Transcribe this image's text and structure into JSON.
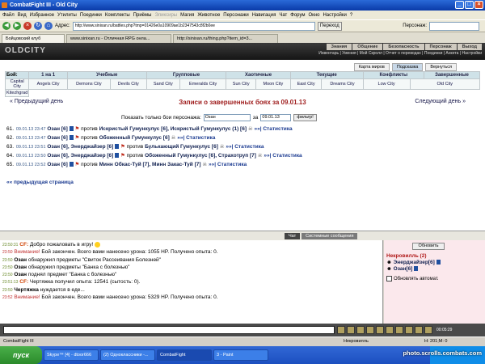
{
  "window": {
    "title": "CombatFight III - Old City"
  },
  "menu": [
    "Файл",
    "Вид",
    "Избранное",
    "Утилиты",
    "Поединки",
    "Комплекты",
    "Приёмы",
    "Эликсиры",
    "Магия",
    "Животное",
    "Персонажи",
    "Навигация",
    "Чат",
    "Форум",
    "Окно",
    "Настройки",
    "?"
  ],
  "navbar": {
    "address_label": "Адрес:",
    "address": "http://www.sinixan.ru/battles.php?tmp=01426e0a10909ae1b2347543c8f2b0ee",
    "go_label": "Переход",
    "person_label": "Персонаж:"
  },
  "tabs": [
    "Бойцовский клуб",
    "www.sinixan.ru - Отличная RPG онла...",
    "http://sinixan.ru/thing.php?item_id=3..."
  ],
  "game": {
    "logo": "OLDCITY",
    "top_menu": [
      "Знания",
      "Общение",
      "Безопасность",
      "Персонаж",
      "Выход"
    ],
    "sub_menu": "Инвентарь | Умения | Мой Скролл | Отчет о переводах | Поединки | Анкета | Настройки",
    "buttons": [
      "Карта миров",
      "Подсказка",
      "Вернуться"
    ],
    "fight_label": "Бой:",
    "fight_types": [
      "1 на 1",
      "Учебные",
      "Групповые",
      "Хаотичные",
      "Текущие",
      "Конфликты",
      "Завершенные"
    ],
    "cities": [
      "Capital City",
      "Angels City",
      "Demons City",
      "Devils City",
      "Sand City",
      "Emeralds City",
      "Sun City",
      "Moon City",
      "East City",
      "Dreams City",
      "Low City",
      "Old City"
    ],
    "cities_row2": [
      "Kitezhgrad"
    ],
    "nav_prev": "« Предыдущий день",
    "nav_next": "Следующий день »",
    "heading": "Записи о завершенных боях за 09.01.13",
    "filter_label": "Показать только бои персонажа:",
    "filter_value": "Озан",
    "filter_for": "за",
    "filter_date": "09.01.13",
    "filter_button": "фильтр!",
    "battles": [
      {
        "num": "61.",
        "time": "09.01.13 23:47",
        "left": "Озан [6]",
        "vs": "против",
        "right": "Искристый Гумункулус [6], Искристый Гумункулус (1) [6]",
        "stat": "»»| Статистика"
      },
      {
        "num": "62.",
        "time": "09.01.13 23:47",
        "left": "Озан [6]",
        "vs": "против",
        "right": "Обоженный Гумункулус [6]",
        "stat": "»»| Статистика"
      },
      {
        "num": "63.",
        "time": "09.01.13 23:51",
        "left": "Озан [6], Энерджайзер [6]",
        "vs": "против",
        "right": "Булькающий Гумункулус [6]",
        "stat": "»»| Статистика"
      },
      {
        "num": "64.",
        "time": "09.01.13 23:50",
        "left": "Озан [6], Энерджайзер [6]",
        "vs": "против",
        "right": "Обоженный Гумункулус [6], Страхотруп [7]",
        "stat": "»»| Статистика"
      },
      {
        "num": "65.",
        "time": "09.01.13 23:52",
        "left": "Озан [6]",
        "vs": "против",
        "right": "Минн Обкас-Туй [7], Минн Закас-Туй [7]",
        "stat": "»»| Статистика"
      }
    ],
    "prev_page": "«« предыдущая страница"
  },
  "chat": {
    "tabs": [
      "Чат",
      "Системные сообщения"
    ],
    "lines": [
      {
        "time": "23:50:31",
        "type": "cf",
        "prefix": "CF:",
        "text": " Добро пожаловать в игру!"
      },
      {
        "time": "23:50",
        "type": "warn",
        "prefix": "Внимание!",
        "text": " Бой закончен. Всего вами нанесено урона: 1055 HP. Получено опыта: 0."
      },
      {
        "time": "23:50",
        "type": "plain",
        "prefix": "Озан",
        "text": " обнаружил предметы \"Свиток Рассеивания Болезней\""
      },
      {
        "time": "23:50",
        "type": "plain",
        "prefix": "Озан",
        "text": " обнаружил предметы \"Банка с болезнью\""
      },
      {
        "time": "23:50",
        "type": "plain",
        "prefix": "Озан",
        "text": " поднял предмет \"Банка с болезнью\""
      },
      {
        "time": "23:51:13",
        "type": "cf",
        "prefix": "CF:",
        "text": " Чертяжка получил опыта: 12541 (сытость: 0)."
      },
      {
        "time": "23:50",
        "type": "plain",
        "prefix": "Чертяжка",
        "text": " нуждается в еде..."
      },
      {
        "time": "23:52",
        "type": "warn",
        "prefix": "Внимание!",
        "text": " Бой закончен. Всего вами нанесено урона: 5329 HP. Получено опыта: 0."
      }
    ]
  },
  "players": {
    "refresh": "Обновить",
    "location": "Некровилль (2)",
    "list": [
      "Энерджайзер[6]",
      "Озан[6]"
    ],
    "auto": "Обновлять автомат."
  },
  "status": {
    "left": "CombatFight III",
    "mid": "Некровилль",
    "right": "Н: 201;М: 0"
  },
  "clock": "00:05:29",
  "taskbar": {
    "start": "пуск",
    "items": [
      "Skype™ [4] - dtoor666",
      "(2) Одноклассники -...",
      "CombatFight",
      "3 - Paint"
    ]
  },
  "watermark": "photo.scrolls.combats.com"
}
